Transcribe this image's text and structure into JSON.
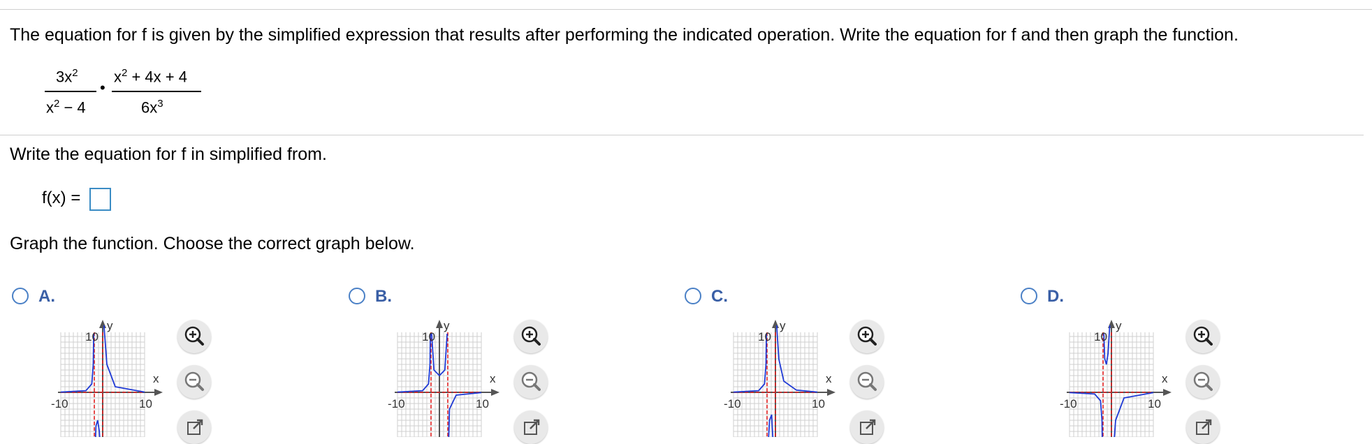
{
  "problem": {
    "intro": "The equation for f is given by the simplified expression that results after performing the indicated operation. Write the equation for f and then graph the function.",
    "expr": {
      "frac1_num": "3x",
      "frac1_num_exp": "2",
      "frac1_den": "x",
      "frac1_den_exp": "2",
      "frac1_den_rest": " − 4",
      "op": "•",
      "frac2_num": "x",
      "frac2_num_exp": "2",
      "frac2_num_rest": " + 4x + 4",
      "frac2_den": "6x",
      "frac2_den_exp": "3"
    }
  },
  "part1": {
    "prompt": "Write the equation for f in simplified from.",
    "fx_label": "f(x) =",
    "answer_value": ""
  },
  "part2": {
    "prompt": "Graph the function. Choose the correct graph below."
  },
  "options": [
    {
      "letter": "A.",
      "y_label": "y",
      "x_label": "x",
      "y_tick": "10",
      "x_min": "-10",
      "x_max": "10"
    },
    {
      "letter": "B.",
      "y_label": "y",
      "x_label": "x",
      "y_tick": "10",
      "x_min": "-10",
      "x_max": "10"
    },
    {
      "letter": "C.",
      "y_label": "y",
      "x_label": "x",
      "y_tick": "10",
      "x_min": "-10",
      "x_max": "10"
    },
    {
      "letter": "D.",
      "y_label": "y",
      "x_label": "x",
      "y_tick": "10",
      "x_min": "-10",
      "x_max": "10"
    }
  ],
  "icons": {
    "zoom_in": "zoom-in-icon",
    "zoom_out": "zoom-out-icon",
    "popout": "popout-icon"
  },
  "colors": {
    "curve": "#1f3ad6",
    "asymptote": "#e02020",
    "grid": "#cfcfcf",
    "option_letter": "#3a5fa6",
    "radio": "#4a80c6"
  }
}
